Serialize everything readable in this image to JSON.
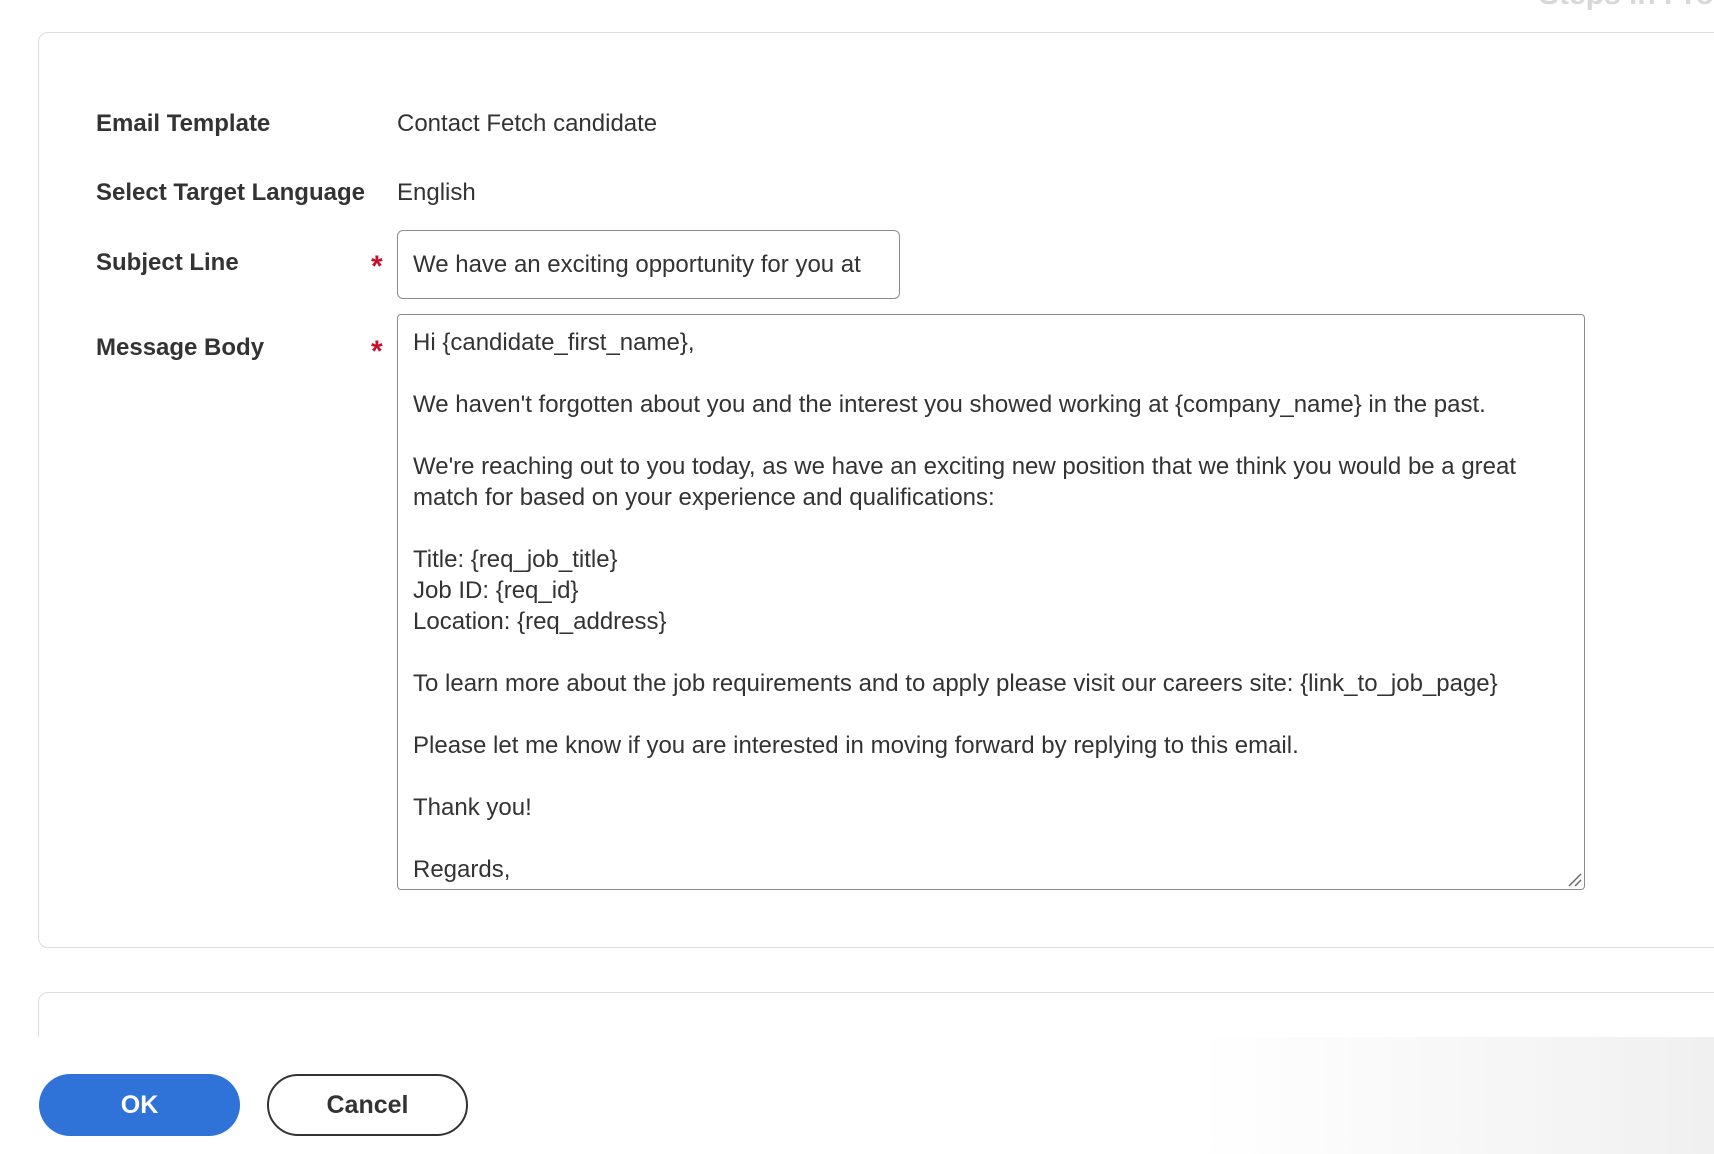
{
  "header": {
    "cut_title": "Steps in Pro"
  },
  "form": {
    "email_template": {
      "label": "Email Template",
      "value": "Contact Fetch candidate"
    },
    "target_language": {
      "label": "Select Target Language",
      "value": "English"
    },
    "subject_line": {
      "label": "Subject Line",
      "required_mark": "*",
      "value": "We have an exciting opportunity for you at"
    },
    "message_body": {
      "label": "Message Body",
      "required_mark": "*",
      "value": "Hi {candidate_first_name},\n\nWe haven't forgotten about you and the interest you showed working at {company_name} in the past.\n\nWe're reaching out to you today, as we have an exciting new position that we think you would be a great match for based on your experience and qualifications:\n\nTitle: {req_job_title}\nJob ID: {req_id}\nLocation: {req_address}\n\nTo learn more about the job requirements and to apply please visit our careers site: {link_to_job_page}\n\nPlease let me know if you are interested in moving forward by replying to this email.\n\nThank you!\n\nRegards,"
    }
  },
  "footer": {
    "ok_label": "OK",
    "cancel_label": "Cancel"
  },
  "colors": {
    "primary": "#2f73d9",
    "required": "#c8102e",
    "text": "#333333",
    "border": "#8c8c8c"
  }
}
